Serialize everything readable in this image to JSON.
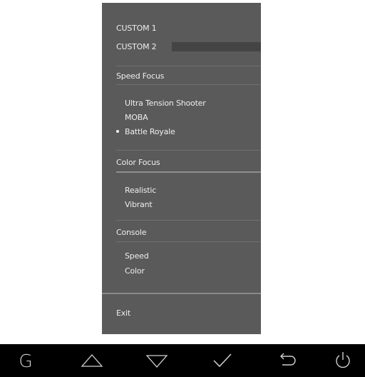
{
  "menu": {
    "custom1": "CUSTOM 1",
    "custom2": "CUSTOM 2",
    "speed_focus_header": "Speed Focus",
    "speed_items": [
      "Ultra Tension Shooter",
      "MOBA",
      "Battle Royale"
    ],
    "speed_selected_index": 2,
    "color_focus_header": "Color Focus",
    "color_items": [
      "Realistic",
      "Vibrant"
    ],
    "console_header": "Console",
    "console_items": [
      "Speed",
      "Color"
    ],
    "exit_label": "Exit"
  },
  "bottom_bar": {
    "keys": [
      "g-key",
      "up-key",
      "down-key",
      "confirm-key",
      "back-key",
      "power-key"
    ]
  }
}
